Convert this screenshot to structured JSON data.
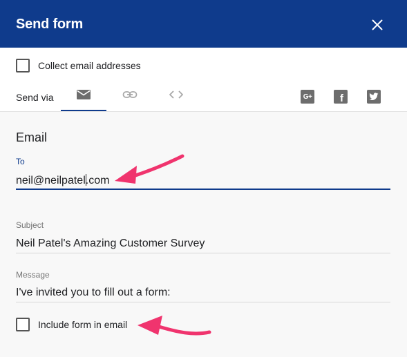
{
  "dialog": {
    "title": "Send form",
    "close_icon": "close-icon"
  },
  "collect_email": {
    "label": "Collect email addresses",
    "checked": false
  },
  "send_via": {
    "label": "Send via",
    "tabs": [
      {
        "name": "email",
        "icon": "envelope-icon",
        "active": true
      },
      {
        "name": "link",
        "icon": "link-icon",
        "active": false
      },
      {
        "name": "embed",
        "icon": "code-icon",
        "active": false
      }
    ],
    "share_icons": [
      "google-plus-icon",
      "facebook-icon",
      "twitter-icon"
    ],
    "google_plus_glyph": "G+",
    "facebook_glyph": "f"
  },
  "email": {
    "section_title": "Email",
    "to_label": "To",
    "to_value_before_caret": "neil@neilpatel",
    "to_value_after_caret": ".com",
    "subject_label": "Subject",
    "subject_value": "Neil Patel's Amazing Customer Survey",
    "message_label": "Message",
    "message_value": "I've invited you to fill out a form:",
    "include_form_label": "Include form in email",
    "include_form_checked": false
  },
  "annotations": {
    "arrow_color": "#f0346e"
  },
  "colors": {
    "header_bg": "#0f3b8c",
    "accent": "#0f3b8c"
  }
}
